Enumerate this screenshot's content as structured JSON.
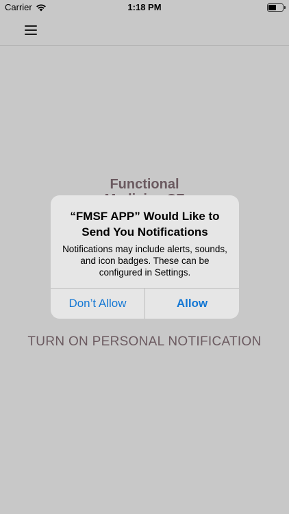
{
  "status_bar": {
    "carrier": "Carrier",
    "time": "1:18 PM",
    "wifi_icon": "wifi-icon",
    "battery_icon": "battery-icon",
    "battery_level": 0.55
  },
  "navbar": {
    "menu_icon": "hamburger-menu-icon"
  },
  "logo": {
    "line1": "Functional",
    "line2": "Medicine SF"
  },
  "main": {
    "notification_button_label": "TURN ON PERSONAL NOTIFICATION"
  },
  "alert": {
    "title": "“FMSF APP” Would Like to Send You Notifications",
    "message": "Notifications may include alerts, sounds, and icon badges. These can be configured in Settings.",
    "dont_allow_label": "Don’t Allow",
    "allow_label": "Allow"
  },
  "colors": {
    "background": "#c8c8c8",
    "accent_text": "#6b5a60",
    "alert_button": "#1578d4",
    "alert_background": "#e6e6e6"
  }
}
